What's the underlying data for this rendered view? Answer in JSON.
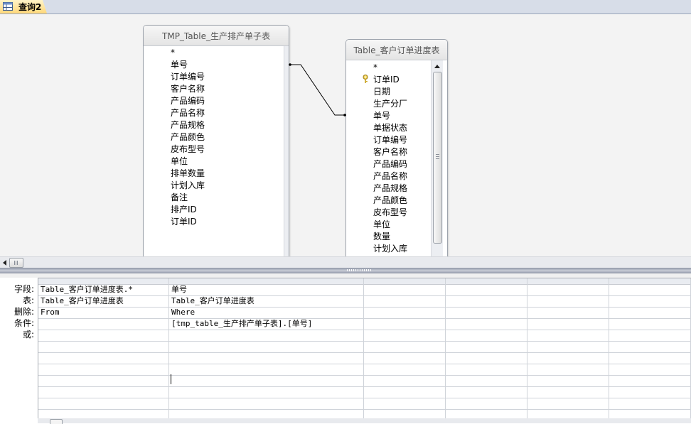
{
  "tab": {
    "label": "查询2"
  },
  "tables": [
    {
      "title": "TMP_Table_生产排产单子表",
      "fields": [
        "*",
        "单号",
        "订单编号",
        "客户名称",
        "产品编码",
        "产品名称",
        "产品规格",
        "产品颜色",
        "皮布型号",
        "单位",
        "排单数量",
        "计划入库",
        "备注",
        "排产ID",
        "订单ID"
      ]
    },
    {
      "title": "Table_客户订单进度表",
      "fields": [
        "*",
        "订单ID",
        "日期",
        "生产分厂",
        "单号",
        "单据状态",
        "订单编号",
        "客户名称",
        "产品编码",
        "产品名称",
        "产品规格",
        "产品颜色",
        "皮布型号",
        "单位",
        "数量",
        "计划入库"
      ]
    }
  ],
  "grid": {
    "row_labels": [
      "字段:",
      "表:",
      "删除:",
      "条件:",
      "或:"
    ],
    "columns": [
      {
        "field": "Table_客户订单进度表.*",
        "table": "Table_客户订单进度表",
        "delete": "From",
        "criteria": ""
      },
      {
        "field": "单号",
        "table": "Table_客户订单进度表",
        "delete": "Where",
        "criteria": "[tmp_table_生产排产单子表].[单号]"
      },
      {
        "field": "",
        "table": "",
        "delete": "",
        "criteria": ""
      },
      {
        "field": "",
        "table": "",
        "delete": "",
        "criteria": ""
      },
      {
        "field": "",
        "table": "",
        "delete": "",
        "criteria": ""
      },
      {
        "field": "",
        "table": "",
        "delete": "",
        "criteria": ""
      }
    ]
  }
}
